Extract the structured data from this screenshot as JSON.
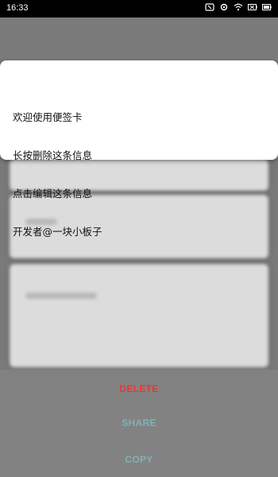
{
  "status_bar": {
    "time": "16:33",
    "icons": [
      "nfc-icon",
      "wifi-icon",
      "signal-icon",
      "battery-icon"
    ]
  },
  "note_popup": {
    "lines": [
      "欢迎使用便签卡",
      "长按删除这条信息",
      "点击编辑这条信息",
      "开发者@一块小板子"
    ]
  },
  "actions": {
    "delete": "DELETE",
    "share": "SHARE",
    "copy": "COPY"
  },
  "colors": {
    "delete": "#e53935",
    "secondary_action": "#7fb1b5"
  }
}
